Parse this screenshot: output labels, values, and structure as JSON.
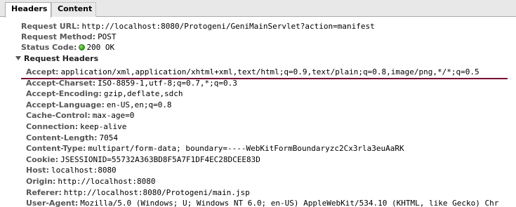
{
  "tabs": {
    "headers": "Headers",
    "content": "Content"
  },
  "general": {
    "request_url_key": "Request URL:",
    "request_url_val": "http://localhost:8080/Protogeni/GeniMainServlet?action=manifest",
    "request_method_key": "Request Method:",
    "request_method_val": "POST",
    "status_code_key": "Status Code:",
    "status_code_val": "200 OK",
    "status_color": "#3aa51e"
  },
  "request_headers": {
    "title": "Request Headers",
    "rows": [
      {
        "key": "Accept:",
        "val": "application/xml,application/xhtml+xml,text/html;q=0.9,text/plain;q=0.8,image/png,*/*;q=0.5"
      },
      {
        "key": "Accept-Charset:",
        "val": "ISO-8859-1,utf-8;q=0.7,*;q=0.3"
      },
      {
        "key": "Accept-Encoding:",
        "val": "gzip,deflate,sdch"
      },
      {
        "key": "Accept-Language:",
        "val": "en-US,en;q=0.8"
      },
      {
        "key": "Cache-Control:",
        "val": "max-age=0"
      },
      {
        "key": "Connection:",
        "val": "keep-alive"
      },
      {
        "key": "Content-Length:",
        "val": "7054"
      },
      {
        "key": "Content-Type:",
        "val": "multipart/form-data; boundary=----WebKitFormBoundaryzc2Cx3rla3euAaRK"
      },
      {
        "key": "Cookie:",
        "val": "JSESSIONID=55732A363BD8F5A7F1DF4EC28DCEE83D"
      },
      {
        "key": "Host:",
        "val": "localhost:8080"
      },
      {
        "key": "Origin:",
        "val": "http://localhost:8080"
      },
      {
        "key": "Referer:",
        "val": "http://localhost:8080/Protogeni/main.jsp"
      },
      {
        "key": "User-Agent:",
        "val": "Mozilla/5.0 (Windows; U; Windows NT 6.0; en-US) AppleWebKit/534.10 (KHTML, like Gecko) Chr"
      }
    ]
  },
  "colors": {
    "key_text": "#575757",
    "annotation_underline": "#7a1030"
  }
}
